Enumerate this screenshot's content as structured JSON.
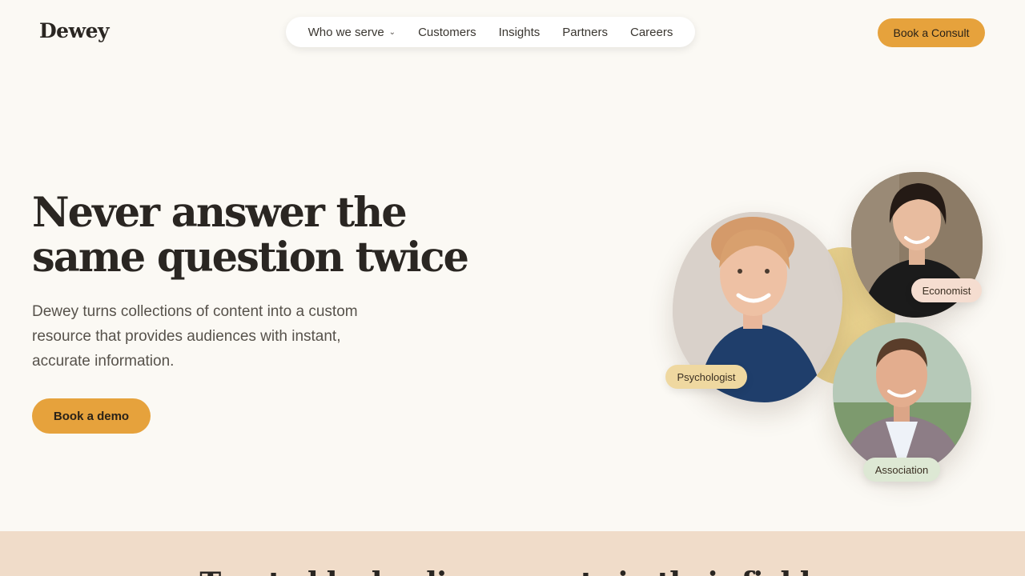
{
  "brand": {
    "logo_text": "Dewey"
  },
  "nav": {
    "items": [
      {
        "label": "Who we serve",
        "has_dropdown": true
      },
      {
        "label": "Customers"
      },
      {
        "label": "Insights"
      },
      {
        "label": "Partners"
      },
      {
        "label": "Careers"
      }
    ],
    "cta_label": "Book a Consult"
  },
  "hero": {
    "headline": "Never answer the same question twice",
    "subtext": "Dewey turns collections of content into a custom resource that provides audiences with instant, accurate information.",
    "cta_label": "Book a demo",
    "profiles": [
      {
        "tag": "Psychologist"
      },
      {
        "tag": "Economist"
      },
      {
        "tag": "Association"
      }
    ]
  },
  "trusted": {
    "heading": "Trusted by leading experts in their fields"
  },
  "colors": {
    "accent": "#e6a23c",
    "background": "#fbf9f4",
    "band": "#f0dcc9",
    "tag_psychologist": "#efd8a0",
    "tag_economist": "#f5ddd0",
    "tag_association": "#dde8d4"
  }
}
